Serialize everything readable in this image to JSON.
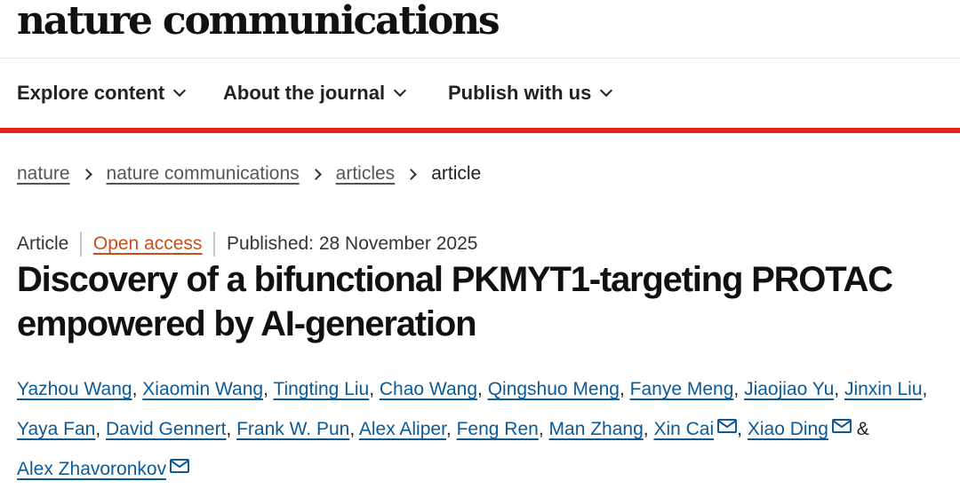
{
  "brand": {
    "logo_text": "nature communications"
  },
  "nav": {
    "items": [
      {
        "label": "Explore content",
        "icon": "chevron-down-icon"
      },
      {
        "label": "About the journal",
        "icon": "chevron-down-icon"
      },
      {
        "label": "Publish with us",
        "icon": "chevron-down-icon"
      }
    ]
  },
  "colors": {
    "accent": "#e2231a",
    "author_link": "#0c5a96",
    "open_access": "#c84e1c"
  },
  "breadcrumb": {
    "items": [
      "nature",
      "nature communications",
      "articles"
    ],
    "current": "article"
  },
  "article": {
    "type": "Article",
    "access": "Open access",
    "published": "Published: 28 November 2025",
    "title": "Discovery of a bifunctional PKMYT1-targeting PROTAC empowered by AI-generation",
    "authors": [
      "Yazhou Wang",
      "Xiaomin Wang",
      "Tingting Liu",
      "Chao Wang",
      "Qingshuo Meng",
      "Fanye Meng",
      "Jiaojiao Yu",
      "Jinxin Liu",
      "Yaya Fan",
      "David Gennert",
      "Frank W. Pun",
      "Alex Aliper",
      "Feng Ren",
      "Man Zhang",
      "Xin Cai",
      "Xiao Ding",
      "Alex Zhavoronkov"
    ],
    "separator_comma": ",",
    "separator_and": "&"
  }
}
